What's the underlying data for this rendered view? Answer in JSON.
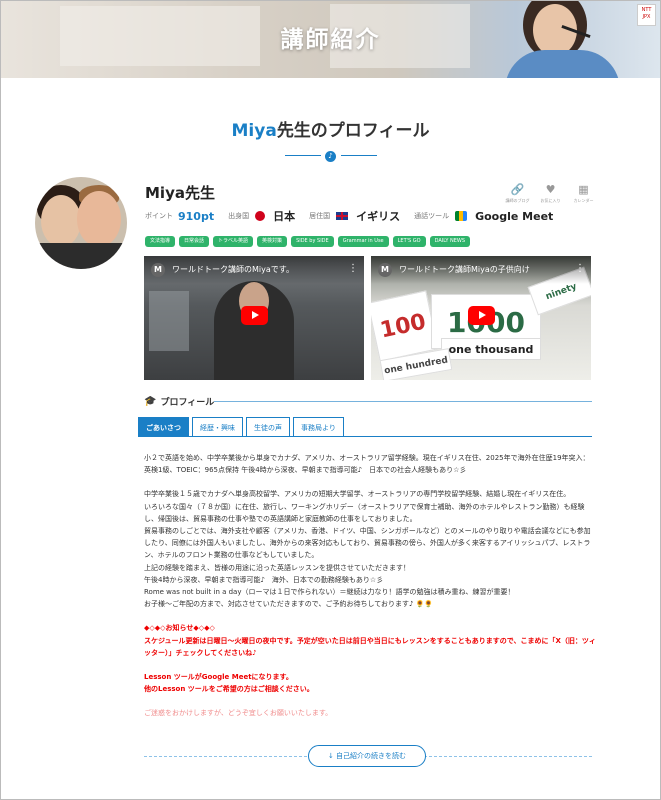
{
  "hero": {
    "title": "講師紹介",
    "badge": "NTT JPX"
  },
  "section": {
    "accent": "Miya",
    "title_rest": "先生のプロフィール",
    "deco": "♪"
  },
  "teacher": {
    "name": "Miya先生",
    "points_label": "ポイント",
    "points": "910pt",
    "origin_label": "出身国",
    "origin": "日本",
    "residence_label": "居住国",
    "residence": "イギリス",
    "tool_label": "通話ツール",
    "tool": "Google Meet"
  },
  "actions": [
    {
      "label": "講師のブログ",
      "icon": "link-icon"
    },
    {
      "label": "お気に入り",
      "icon": "heart-icon"
    },
    {
      "label": "カレンダー",
      "icon": "calendar-icon"
    }
  ],
  "tags": [
    "文法指導",
    "日常会話",
    "トラベル英語",
    "英検対策",
    "SIDE by SIDE",
    "Grammar in Use",
    "LET'S GO",
    "DAILY NEWS"
  ],
  "videos": [
    {
      "logo": "M",
      "title": "ワールドトーク講師のMiyaです。"
    },
    {
      "logo": "M",
      "title": "ワールドトーク講師Miyaの子供向け",
      "cards": [
        "100",
        "1000",
        "one thousand",
        "ninety",
        "one hundred"
      ]
    }
  ],
  "profile": {
    "heading": "プロフィール",
    "tabs": [
      "ごあいさつ",
      "経歴・興味",
      "生徒の声",
      "事務局より"
    ],
    "paragraphs": [
      "小２で英語を始め、中学卒業後から単身でカナダ、アメリカ、オーストラリア留学経験。現在イギリス在住、2025年で海外在住歴19年突入：英検1級、TOEIC：965点保持 午後4時から深夜、早朝まで指導可能♪　日本での社会人経験もあり☆彡",
      "中学卒業後１５歳でカナダへ単身高校留学、アメリカの短期大学留学、オーストラリアの専門学校留学経験、結婚し現在イギリス在住。",
      "いろいろな国々（７８か国）に在住、旅行し、ワーキングホリデー（オーストラリアで保育士補助、海外のホテルやレストラン勤務）も経験し、帰国後は、貿易事務の仕事や塾での英語講師と家庭教師の仕事をしておりました。",
      "貿易事務のしごとでは、海外支社や顧客（アメリカ、香港、ドイツ、中国、シンガポールなど）とのメールのやり取りや電話会議などにも参加したり、同僚には外国人もいましたし、海外からの来客対応もしており、貿易事務の傍ら、外国人が多く来客するアイリッシュパブ、レストラン、ホテルのフロント業務の仕事などもしていました。",
      "上記の経験を踏まえ、皆様の用途に沿った英語レッスンを提供させていただきます！",
      "午後4時から深夜、早朝まで指導可能♪　海外、日本での勤務経験もあり☆彡",
      "Rome was not built in a day（ローマは１日で作られない）＝継続は力なり！語学の勉強は積み重ね、練習が重要！",
      "お子様〜ご年配の方まで、対応させていただきますので、ご予約お待ちしております♪ 🌻🌻"
    ],
    "notice_title": "◆◇◆◇お知らせ◆◇◆◇",
    "notice_1": "スケジュール更新は日曜日〜火曜日の夜中です。予定が空いた日は前日や当日にもレッスンをすることもありますので、こまめに「X（旧：ツィッター）」チェックしてくださいね♪",
    "notice_2": "Lesson ツールがGoogle Meetになります。",
    "notice_3": "他のLesson ツールをご希望の方はご相談ください。",
    "apology": "ご迷惑をおかけしますが、どうぞ宜しくお願いいたします。",
    "read_more": "自己紹介の続きを読む"
  },
  "colors": {
    "accent": "#1a7fc6",
    "tag": "#2fb36a",
    "notice": "#ee0000",
    "apology": "#f08d8d"
  }
}
